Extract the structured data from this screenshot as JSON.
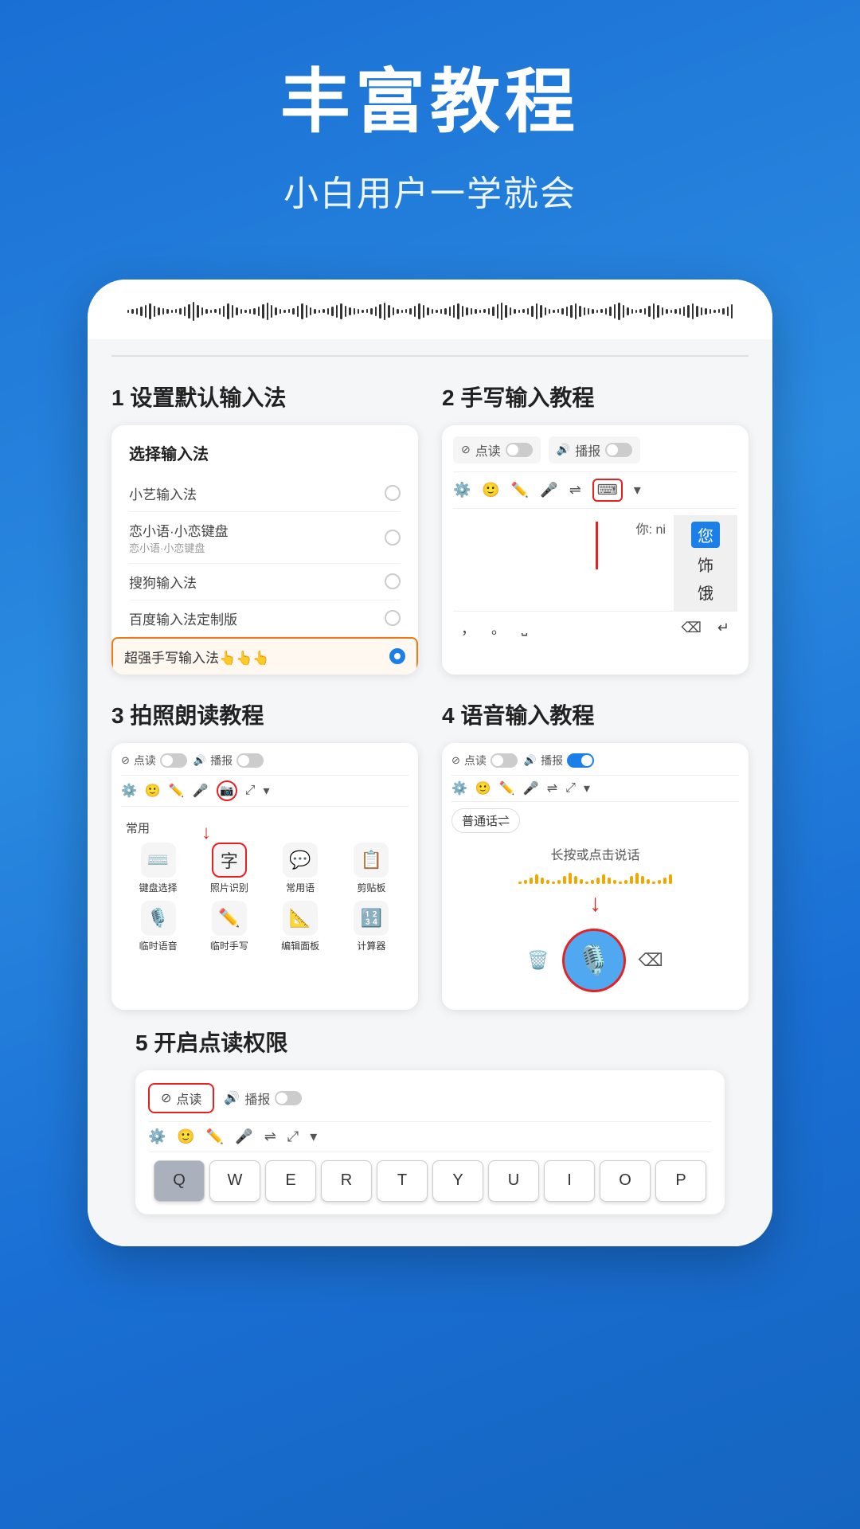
{
  "header": {
    "title": "丰富教程",
    "subtitle": "小白用户一学就会"
  },
  "tutorials": [
    {
      "id": 1,
      "label": "1 设置默认输入法",
      "card_title": "选择输入法",
      "items": [
        {
          "name": "小艺输入法",
          "sub": "",
          "selected": false
        },
        {
          "name": "恋小语·小恋键盘",
          "sub": "恋小语·小恋键盘",
          "selected": false
        },
        {
          "name": "搜狗输入法",
          "sub": "",
          "selected": false
        },
        {
          "name": "百度输入法定制版",
          "sub": "",
          "selected": false
        },
        {
          "name": "超强手写输入法👆👆👆",
          "sub": "",
          "selected": true
        }
      ]
    },
    {
      "id": 2,
      "label": "2 手写输入教程",
      "reading_toggle": "点读",
      "broadcast_toggle": "播报",
      "you_ni": "你: ni",
      "candidates": [
        "您",
        "饰",
        "饿"
      ],
      "candidate_highlight": "您"
    },
    {
      "id": 3,
      "label": "3 拍照朗读教程",
      "reading_toggle": "点读",
      "broadcast_toggle": "播报",
      "menu_title": "常用",
      "menu_items": [
        {
          "icon": "⌨️",
          "label": "键盘选择"
        },
        {
          "icon": "字",
          "label": "照片识别",
          "highlighted": true
        },
        {
          "icon": "💬",
          "label": "常用语"
        },
        {
          "icon": "📋",
          "label": "剪贴板"
        },
        {
          "icon": "🎙️",
          "label": "临时语音"
        },
        {
          "icon": "✏️",
          "label": "临时手写"
        },
        {
          "icon": "📐",
          "label": "编辑面板"
        },
        {
          "icon": "🔢",
          "label": "计算器"
        }
      ]
    },
    {
      "id": 4,
      "label": "4 语音输入教程",
      "reading_toggle": "点读",
      "broadcast_toggle": "播报",
      "lang_btn": "普通话⇌",
      "hint": "长按或点击说话",
      "mic_icon": "🎙️"
    }
  ],
  "section5": {
    "label": "5 开启点读权限",
    "reading_btn": "点读",
    "broadcast_btn": "播报",
    "keyboard_keys": [
      "Q",
      "W",
      "E",
      "R",
      "T",
      "Y",
      "U",
      "I",
      "O",
      "P"
    ]
  },
  "icons": {
    "gear": "⚙️",
    "face": "🙂",
    "pen": "✏️",
    "mic": "🎤",
    "translate": "⇌",
    "expand": "⤢",
    "chevron": "▾",
    "reading": "📖",
    "volume": "🔊",
    "camera": "📷"
  }
}
